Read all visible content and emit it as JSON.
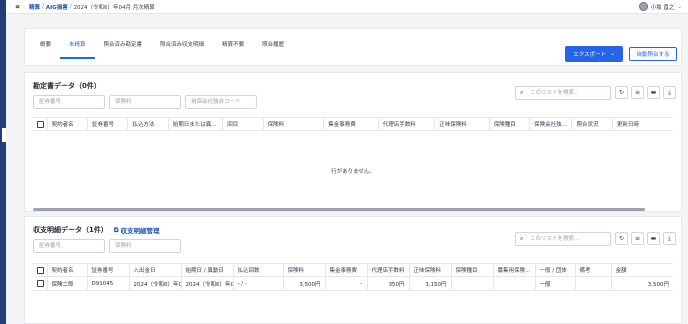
{
  "breadcrumb": {
    "root": "精算",
    "section": "AIG損害",
    "current": "2024（令和6）年04月 月次精算"
  },
  "user": {
    "name": "小坂 直之"
  },
  "tabs": [
    "概要",
    "未精算",
    "照合済み勘定書",
    "照合済み収支明細",
    "精算不要",
    "照合履歴"
  ],
  "active_tab": 1,
  "actions": {
    "export": "エクスポート",
    "auto_match": "自動照合する"
  },
  "statement": {
    "title": "勘定書データ（0件）",
    "filters": {
      "policy_no": "証券番号",
      "premium": "保険料",
      "agency_code": "損保会社独自コード"
    },
    "search_placeholder": "このリストを検索...",
    "columns": [
      "契約者名",
      "証券番号",
      "払込方法",
      "始期日または異…",
      "回目",
      "保険料",
      "集金事務費",
      "代理店手数料",
      "正味保険料",
      "保険種目",
      "保険会社独…",
      "照合状況",
      "更新日時"
    ],
    "empty_message": "行がありません。"
  },
  "ledger": {
    "title": "収支明細データ（1件）",
    "manage_link": "収支明細管理",
    "filters": {
      "policy_no": "証券番号",
      "premium": "保険料"
    },
    "search_placeholder": "このリストを検索...",
    "columns": [
      "契約者名",
      "証券番号",
      "入出金日",
      "始期日 / 異動日",
      "払込回数",
      "保険料",
      "集金事務費",
      "代理店手数料",
      "正味保険料",
      "保険種目",
      "募集用保険…",
      "一般 / 団体",
      "備考",
      "金額"
    ],
    "rows": [
      [
        "保険二郎",
        "D91045",
        "2024（令和6）年0",
        "2024（令和6）年0",
        "- / -",
        "3,500円",
        "-",
        "350円",
        "3,150円",
        "",
        "",
        "一般",
        "",
        "3,500円"
      ]
    ]
  }
}
